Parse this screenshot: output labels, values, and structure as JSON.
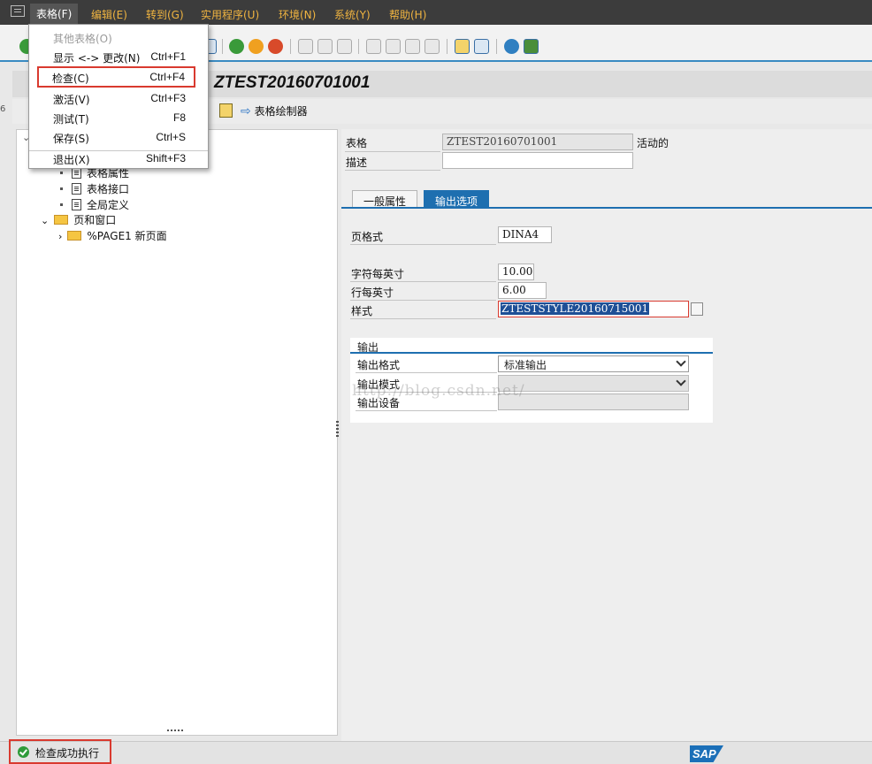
{
  "menubar": {
    "items": [
      {
        "label": "表格(F)"
      },
      {
        "label": "编辑(E)"
      },
      {
        "label": "转到(G)"
      },
      {
        "label": "实用程序(U)"
      },
      {
        "label": "环境(N)"
      },
      {
        "label": "系统(Y)"
      },
      {
        "label": "帮助(H)"
      }
    ]
  },
  "dropdown": {
    "items": [
      {
        "label": "其他表格(O)",
        "shortcut": "",
        "state": "disabled"
      },
      {
        "label": "显示 <-> 更改(N)",
        "shortcut": "Ctrl+F1",
        "state": "normal"
      },
      {
        "label": "检查(C)",
        "shortcut": "Ctrl+F4",
        "state": "highlighted"
      },
      {
        "label": "激活(V)",
        "shortcut": "Ctrl+F3",
        "state": "normal"
      },
      {
        "label": "测试(T)",
        "shortcut": "F8",
        "state": "normal"
      },
      {
        "label": "保存(S)",
        "shortcut": "Ctrl+S",
        "state": "normal"
      },
      {
        "label": "退出(X)",
        "shortcut": "Shift+F3",
        "state": "normal"
      }
    ]
  },
  "title": {
    "text": "ZTEST20160701001"
  },
  "app_toolbar": {
    "row_marker": "6",
    "form_painter_label": "表格绘制器"
  },
  "tree": {
    "items": [
      {
        "label": "表格属性"
      },
      {
        "label": "表格接口"
      },
      {
        "label": "全局定义"
      },
      {
        "label": "页和窗口"
      },
      {
        "label": "%PAGE1 新页面"
      }
    ]
  },
  "form_header": {
    "form_label": "表格",
    "form_value": "ZTEST20160701001",
    "form_status": "活动的",
    "description_label": "描述",
    "description_value": ""
  },
  "tabs": [
    {
      "label": "一般属性",
      "active": false
    },
    {
      "label": "输出选项",
      "active": true
    }
  ],
  "output_options": {
    "page_format_label": "页格式",
    "page_format_value": "DINA4",
    "cpi_label": "字符每英寸",
    "cpi_value": "10.00",
    "lpi_label": "行每英寸",
    "lpi_value": "6.00",
    "style_label": "样式",
    "style_value": "ZTESTSTYLE20160715001"
  },
  "output_group": {
    "title": "输出",
    "format_label": "输出格式",
    "format_value": "标准输出",
    "mode_label": "输出模式",
    "mode_value": "",
    "device_label": "输出设备",
    "device_value": ""
  },
  "watermark": {
    "text": "http://blog.csdn.net/"
  },
  "status": {
    "message": "检查成功执行",
    "icon": "success-check-icon"
  },
  "colors": {
    "accent": "#1e6fb0",
    "menu_text": "#f0b440",
    "highlight_border": "#d93a2f"
  }
}
